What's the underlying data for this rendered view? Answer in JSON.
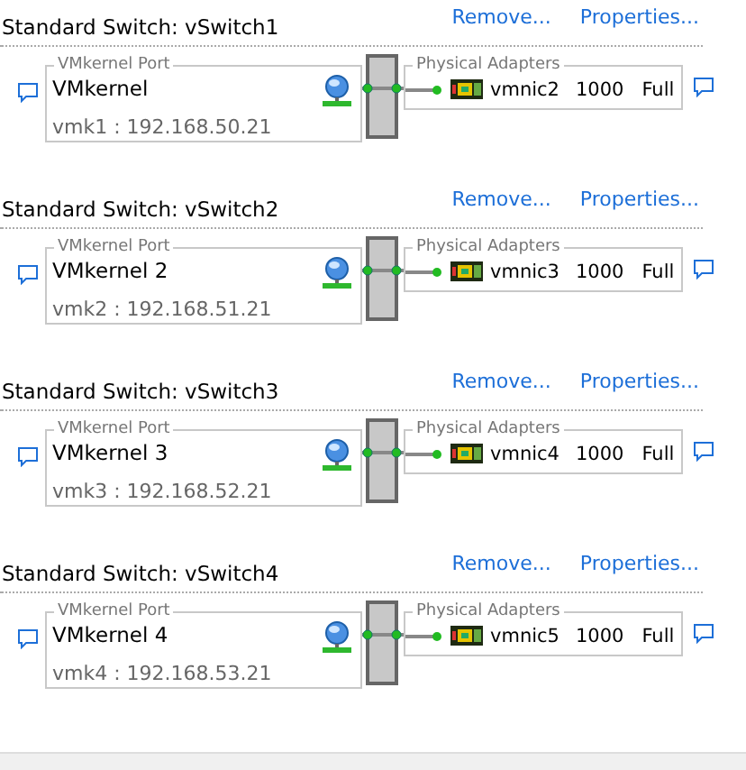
{
  "switches": [
    {
      "title": "Standard Switch: vSwitch1",
      "actions": [
        "Remove...",
        "Properties..."
      ],
      "port": {
        "legend": "VMkernel Port",
        "name": "VMkernel",
        "address": "vmk1 : 192.168.50.21"
      },
      "adapters": {
        "legend": "Physical Adapters",
        "nic": "vmnic2",
        "speed": "1000",
        "duplex": "Full"
      }
    },
    {
      "title": "Standard Switch: vSwitch2",
      "actions": [
        "Remove...",
        "Properties..."
      ],
      "port": {
        "legend": "VMkernel Port",
        "name": "VMkernel 2",
        "address": "vmk2 : 192.168.51.21"
      },
      "adapters": {
        "legend": "Physical Adapters",
        "nic": "vmnic3",
        "speed": "1000",
        "duplex": "Full"
      }
    },
    {
      "title": "Standard Switch: vSwitch3",
      "actions": [
        "Remove...",
        "Properties..."
      ],
      "port": {
        "legend": "VMkernel Port",
        "name": "VMkernel 3",
        "address": "vmk3 : 192.168.52.21"
      },
      "adapters": {
        "legend": "Physical Adapters",
        "nic": "vmnic4",
        "speed": "1000",
        "duplex": "Full"
      }
    },
    {
      "title": "Standard Switch: vSwitch4",
      "actions": [
        "Remove...",
        "Properties..."
      ],
      "port": {
        "legend": "VMkernel Port",
        "name": "VMkernel 4",
        "address": "vmk4 : 192.168.53.21"
      },
      "adapters": {
        "legend": "Physical Adapters",
        "nic": "vmnic5",
        "speed": "1000",
        "duplex": "Full"
      }
    }
  ]
}
